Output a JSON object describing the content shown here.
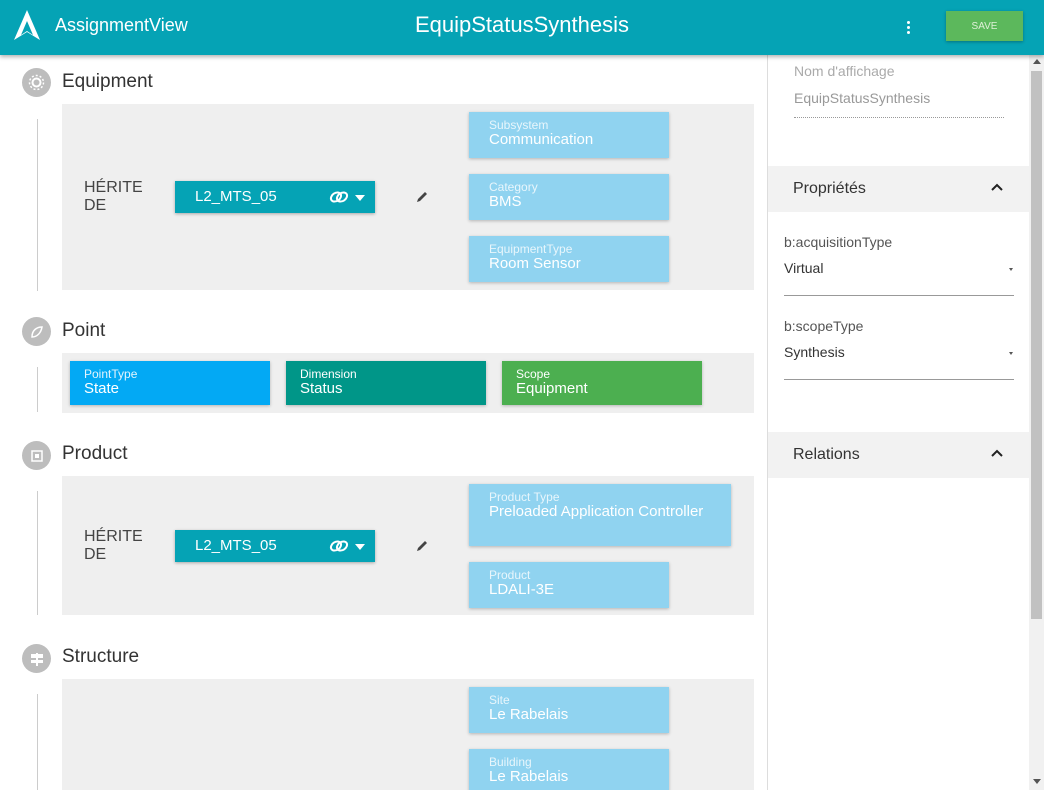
{
  "header": {
    "app_name": "AssignmentView",
    "title": "EquipStatusSynthesis",
    "save_label": "SAVE",
    "menu_icon": "more-vert-icon",
    "logo_icon": "a-logo-icon"
  },
  "colors": {
    "header": "#05a3b5",
    "save": "#5cb85c",
    "card_light": "#90d3f0",
    "point_type": "#03a9f4",
    "dimension": "#009688",
    "scope": "#4caf50"
  },
  "sections": {
    "equipment": {
      "title": "Equipment",
      "icon": "gears-icon",
      "inherits_label": "HÉRITE DE",
      "inherits_value": "L2_MTS_05",
      "cards": [
        {
          "key": "Subsystem",
          "value": "Communication"
        },
        {
          "key": "Category",
          "value": "BMS"
        },
        {
          "key": "EquipmentType",
          "value": "Room Sensor"
        }
      ]
    },
    "point": {
      "title": "Point",
      "icon": "point-icon",
      "cards": [
        {
          "key": "PointType",
          "value": "State"
        },
        {
          "key": "Dimension",
          "value": "Status"
        },
        {
          "key": "Scope",
          "value": "Equipment"
        }
      ]
    },
    "product": {
      "title": "Product",
      "icon": "chip-icon",
      "inherits_label": "HÉRITE DE",
      "inherits_value": "L2_MTS_05",
      "cards": [
        {
          "key": "Product Type",
          "value": "Preloaded Application Controller"
        },
        {
          "key": "Product",
          "value": "LDALI-3E"
        }
      ]
    },
    "structure": {
      "title": "Structure",
      "icon": "signpost-icon",
      "cards": [
        {
          "key": "Site",
          "value": "Le Rabelais"
        },
        {
          "key": "Building",
          "value": "Le Rabelais"
        }
      ]
    }
  },
  "sidebar": {
    "display_name_label": "Nom d'affichage",
    "display_name_value": "EquipStatusSynthesis",
    "properties_title": "Propriétés",
    "properties": [
      {
        "label": "b:acquisitionType",
        "value": "Virtual"
      },
      {
        "label": "b:scopeType",
        "value": "Synthesis"
      }
    ],
    "relations_title": "Relations"
  }
}
